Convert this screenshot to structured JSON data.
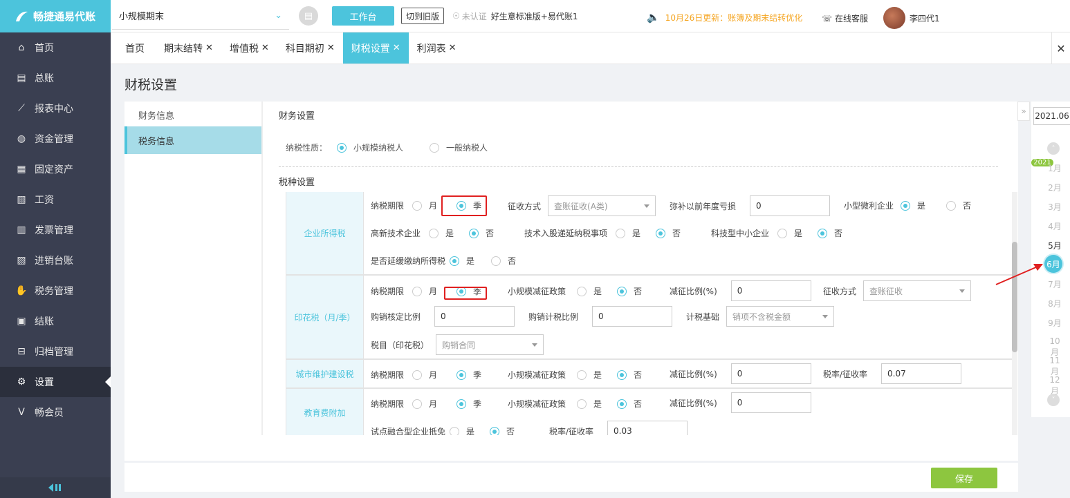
{
  "brand": {
    "name": "畅捷通易代账"
  },
  "sidebar": {
    "items": [
      {
        "label": "首页",
        "icon": "home-icon"
      },
      {
        "label": "总账",
        "icon": "ledger-icon"
      },
      {
        "label": "报表中心",
        "icon": "chart-icon"
      },
      {
        "label": "资金管理",
        "icon": "wallet-icon"
      },
      {
        "label": "固定资产",
        "icon": "asset-icon"
      },
      {
        "label": "工资",
        "icon": "salary-icon"
      },
      {
        "label": "发票管理",
        "icon": "invoice-icon"
      },
      {
        "label": "进销台账",
        "icon": "inventory-icon"
      },
      {
        "label": "税务管理",
        "icon": "tax-icon"
      },
      {
        "label": "结账",
        "icon": "close-book-icon"
      },
      {
        "label": "归档管理",
        "icon": "archive-icon"
      },
      {
        "label": "设置",
        "icon": "gear-icon"
      },
      {
        "label": "畅会员",
        "icon": "vip-icon"
      }
    ],
    "active_index": 11
  },
  "topbar": {
    "company": "小规模期末",
    "workbench": "工作台",
    "switch_old": "切到旧版",
    "cert_status": "未认证",
    "edition": "好生意标准版+易代账1",
    "notice": "10月26日更新：账簿及期末结转优化",
    "service": "在线客服",
    "user": "李四代1"
  },
  "tabs": [
    {
      "label": "首页",
      "closable": false
    },
    {
      "label": "期末结转",
      "closable": true
    },
    {
      "label": "增值税",
      "closable": true
    },
    {
      "label": "科目期初",
      "closable": true
    },
    {
      "label": "财税设置",
      "closable": true,
      "active": true
    },
    {
      "label": "利润表",
      "closable": true
    }
  ],
  "page": {
    "title": "财税设置",
    "leftnav": [
      "财务信息",
      "税务信息"
    ],
    "leftnav_active": 1,
    "finance_section": "财务设置",
    "taxpayer_label": "纳税性质：",
    "taxpayer_options": [
      "小规模纳税人",
      "一般纳税人"
    ],
    "taxpayer_selected": "小规模纳税人",
    "tax_section": "税种设置"
  },
  "corp_income_tax": {
    "label": "企业所得税",
    "period_label": "纳税期限",
    "month": "月",
    "quarter": "季",
    "period_value": "季",
    "collect_label": "征收方式",
    "collect_value": "查账征收(A类)",
    "loss_label": "弥补以前年度亏损",
    "loss_value": "0",
    "small_label": "小型微利企业",
    "yes": "是",
    "no": "否",
    "small_value": "是",
    "hitech_label": "高新技术企业",
    "hitech_value": "否",
    "tech_invest_label": "技术入股递延纳税事项",
    "tech_invest_value": "否",
    "sme_label": "科技型中小企业",
    "sme_value": "否",
    "defer_label": "是否延缓缴纳所得税",
    "defer_value": "是"
  },
  "stamp_tax": {
    "label": "印花税（月/季）",
    "period_label": "纳税期限",
    "month": "月",
    "quarter": "季",
    "period_value": "季",
    "policy_label": "小规模减征政策",
    "yes": "是",
    "no": "否",
    "policy_value": "否",
    "reduce_label": "减征比例(%)",
    "reduce_value": "0",
    "collect_label": "征收方式",
    "collect_value": "查账征收",
    "purchase_ratio_label": "购销核定比例",
    "purchase_ratio_value": "0",
    "purchase_tax_label": "购销计税比例",
    "purchase_tax_value": "0",
    "basis_label": "计税基础",
    "basis_value": "销项不含税金额",
    "item_label": "税目（印花税）",
    "item_value": "购销合同"
  },
  "city_tax": {
    "label": "城市维护建设税",
    "period_label": "纳税期限",
    "month": "月",
    "quarter": "季",
    "period_value": "季",
    "policy_label": "小规模减征政策",
    "yes": "是",
    "no": "否",
    "policy_value": "否",
    "reduce_label": "减征比例(%)",
    "reduce_value": "0",
    "rate_label": "税率/征收率",
    "rate_value": "0.07"
  },
  "edu_tax": {
    "label": "教育费附加",
    "period_label": "纳税期限",
    "month": "月",
    "quarter": "季",
    "period_value": "季",
    "policy_label": "小规模减征政策",
    "yes": "是",
    "no": "否",
    "policy_value": "否",
    "reduce_label": "减征比例(%)",
    "reduce_value": "0",
    "pilot_label": "试点融合型企业抵免",
    "pilot_value": "否",
    "rate_label": "税率/征收率",
    "rate_value": "0.03"
  },
  "save": "保存",
  "period": {
    "current": "2021.06",
    "year": "2021",
    "months": [
      "1月",
      "2月",
      "3月",
      "4月",
      "5月",
      "6月",
      "7月",
      "8月",
      "9月",
      "10月",
      "11月",
      "12月"
    ],
    "selected_index": 5,
    "available": [
      4,
      5
    ]
  }
}
